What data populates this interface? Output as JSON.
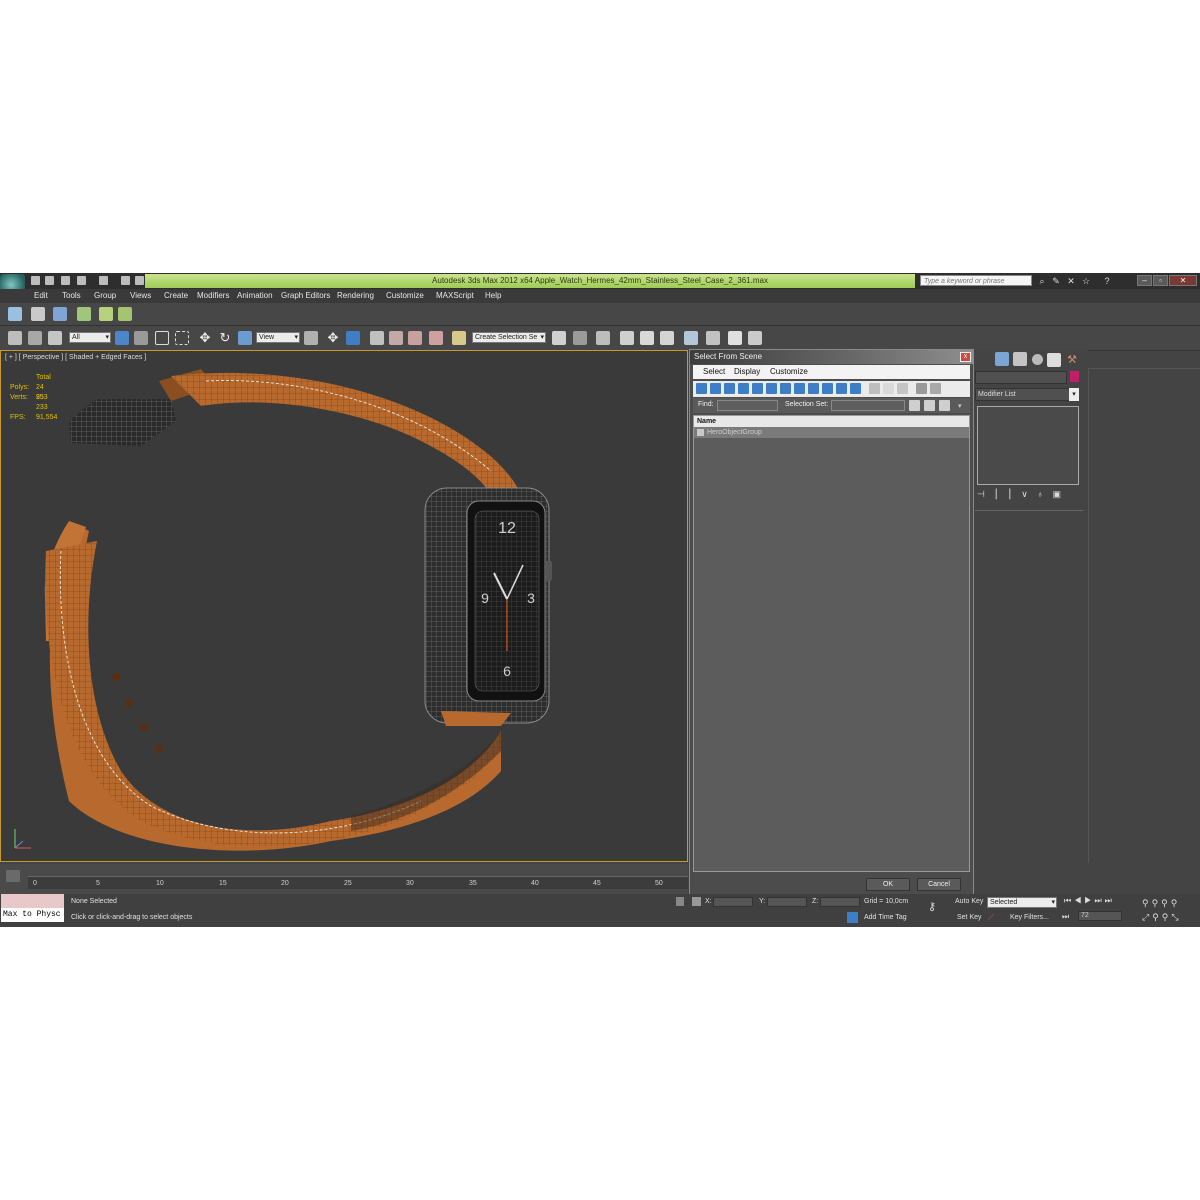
{
  "app": {
    "title": "Autodesk 3ds Max  2012 x64     Apple_Watch_Hermes_42mm_Stainless_Steel_Case_2_361.max",
    "search_placeholder": "Type a keyword or phrase"
  },
  "menu": [
    "Edit",
    "Tools",
    "Group",
    "Views",
    "Create",
    "Modifiers",
    "Animation",
    "Graph Editors",
    "Rendering",
    "Customize",
    "MAXScript",
    "Help"
  ],
  "toolbar": {
    "filter_value": "All",
    "coord_value": "View",
    "selection_set_placeholder": "Create Selection Se"
  },
  "viewport": {
    "label": "[ + ] [ Perspective ] [ Shaded + Edged Faces ]",
    "stats_header": "Total",
    "stats": [
      {
        "label": "Polys:",
        "value": "24 953"
      },
      {
        "label": "Verts:",
        "value": "25 233"
      },
      {
        "label": "FPS:",
        "value": "91,554"
      }
    ]
  },
  "command_panel": {
    "modifier_list": "Modifier List"
  },
  "dialog": {
    "title": "Select From Scene",
    "close": "x",
    "menu": [
      "Select",
      "Display",
      "Customize"
    ],
    "find_label": "Find:",
    "selection_set_label": "Selection Set:",
    "column_header": "Name",
    "rows": [
      "HeroObjectGroup"
    ],
    "ok": "OK",
    "cancel": "Cancel"
  },
  "timeline": {
    "ticks": [
      "0",
      "5",
      "10",
      "15",
      "20",
      "25",
      "30",
      "35",
      "40",
      "45",
      "50"
    ]
  },
  "status": {
    "maxscript_listener": "Max to Physc",
    "selection": "None Selected",
    "prompt": "Click or click-and-drag to select objects",
    "x_label": "X:",
    "y_label": "Y:",
    "z_label": "Z:",
    "grid": "Grid = 10,0cm",
    "add_time_tag": "Add Time Tag",
    "auto_key": "Auto Key",
    "set_key": "Set Key",
    "key_mode": "Selected",
    "key_filters": "Key Filters...",
    "frame": "72"
  },
  "colors": {
    "title_green": "#a8d060",
    "viewport_border": "#c79a2a",
    "strap": "#b86a2e",
    "stats": "#e3c000"
  }
}
